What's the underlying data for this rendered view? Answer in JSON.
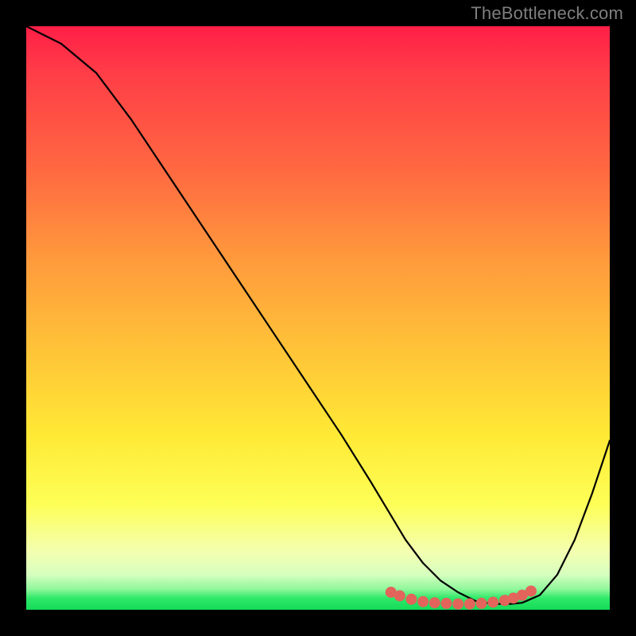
{
  "watermark": "TheBottleneck.com",
  "chart_data": {
    "type": "line",
    "title": "",
    "xlabel": "",
    "ylabel": "",
    "xlim": [
      0,
      100
    ],
    "ylim": [
      0,
      100
    ],
    "grid": false,
    "series": [
      {
        "name": "curve",
        "x": [
          0,
          6,
          12,
          18,
          24,
          30,
          36,
          42,
          48,
          54,
          59,
          62,
          65,
          68,
          71,
          74,
          77,
          80,
          83,
          85,
          88,
          91,
          94,
          97,
          100
        ],
        "y": [
          100,
          97,
          92,
          84,
          75,
          66,
          57,
          48,
          39,
          30,
          22,
          17,
          12,
          8,
          5,
          3,
          1.5,
          1,
          1,
          1.2,
          2.5,
          6,
          12,
          20,
          29
        ]
      }
    ],
    "markers": {
      "name": "bottom-dots",
      "x": [
        62.5,
        64,
        66,
        68,
        70,
        72,
        74,
        76,
        78,
        80,
        82,
        83.5,
        85,
        86.5
      ],
      "y": [
        3.0,
        2.4,
        1.8,
        1.4,
        1.2,
        1.1,
        1.0,
        1.0,
        1.1,
        1.3,
        1.6,
        2.0,
        2.5,
        3.2
      ],
      "color": "#e2645b",
      "radius_px": 7
    },
    "gradient_colors": {
      "top": "#ff1f47",
      "mid_high": "#ff9a3c",
      "mid": "#ffe935",
      "low": "#f4ffb0",
      "bottom": "#14db58"
    }
  }
}
